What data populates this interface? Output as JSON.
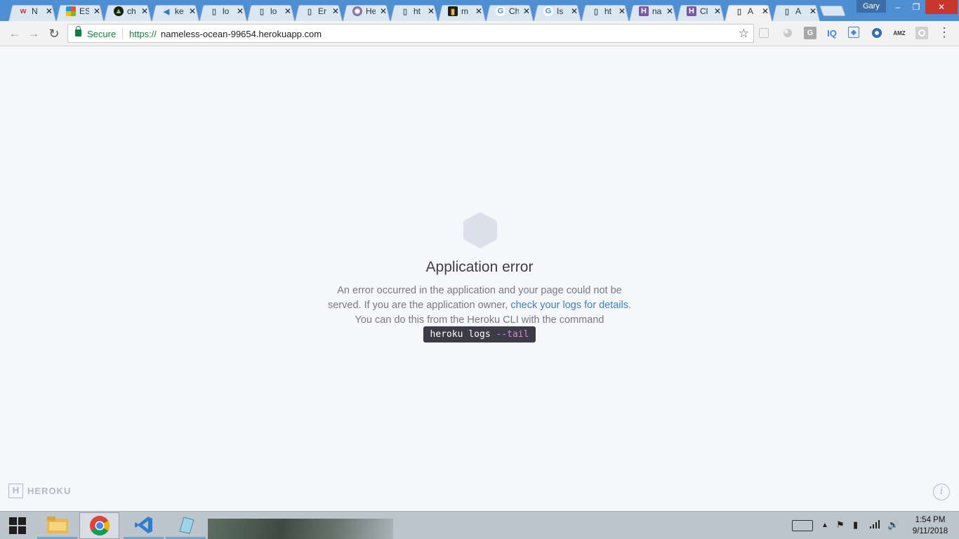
{
  "browser": {
    "tabs": [
      {
        "title": "N",
        "favicon": "icon-red-w",
        "active": false
      },
      {
        "title": "ES",
        "favicon": "icon-microsoft",
        "active": false
      },
      {
        "title": "ch",
        "favicon": "icon-dark-circle",
        "active": false
      },
      {
        "title": "ke",
        "favicon": "icon-vscode",
        "active": false
      },
      {
        "title": "lo",
        "favicon": "page-icon",
        "active": false
      },
      {
        "title": "lo",
        "favicon": "page-icon",
        "active": false
      },
      {
        "title": "Er",
        "favicon": "page-icon",
        "active": false
      },
      {
        "title": "He",
        "favicon": "icon-purple-circle",
        "active": false
      },
      {
        "title": "ht",
        "favicon": "page-icon",
        "active": false
      },
      {
        "title": "m",
        "favicon": "icon-dark-square",
        "active": false
      },
      {
        "title": "Ch",
        "favicon": "google-icon",
        "active": false
      },
      {
        "title": "Is",
        "favicon": "google-icon",
        "active": false
      },
      {
        "title": "ht",
        "favicon": "page-icon",
        "active": false
      },
      {
        "title": "na",
        "favicon": "heroku-icon",
        "active": false
      },
      {
        "title": "Cl",
        "favicon": "heroku-icon",
        "active": false
      },
      {
        "title": "A",
        "favicon": "page-icon",
        "active": true
      },
      {
        "title": "A",
        "favicon": "page-icon",
        "active": false
      }
    ],
    "close_glyph": "✕",
    "profile_name": "Gary",
    "omnibox": {
      "secure_label": "Secure",
      "url_scheme": "https://",
      "url_host": "nameless-ocean-99654.herokuapp.com"
    }
  },
  "page": {
    "title": "Application error",
    "message_line1": "An error occurred in the application and your page could not be served. If you are the application owner, ",
    "message_link": "check your logs for details",
    "message_line2": ". You can do this from the Heroku CLI with the command",
    "command_base": "heroku logs",
    "command_flag": "--tail",
    "footer_brand": "HEROKU",
    "info_glyph": "i"
  },
  "taskbar": {
    "time": "1:54 PM",
    "date": "9/11/2018"
  },
  "colors": {
    "link": "#3a7fc4",
    "secure_green": "#0b8043",
    "heroku_purple": "#79589f",
    "command_bg": "#3c3b46"
  }
}
